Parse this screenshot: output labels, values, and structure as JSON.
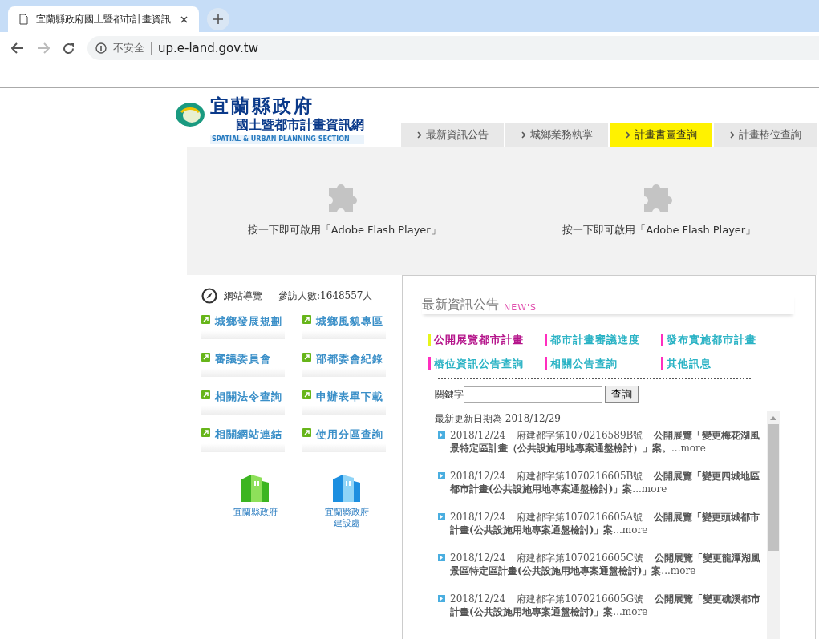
{
  "browser": {
    "tab_title": "宜蘭縣政府國土暨都市計畫資訊",
    "security": "不安全",
    "url": "up.e-land.gov.tw"
  },
  "logo": {
    "title": "宜蘭縣政府",
    "subtitle": "國土暨都市計畫資訊網",
    "english": "SPATIAL & URBAN PLANNING SECTION"
  },
  "nav_tabs": [
    {
      "label": "最新資訊公告",
      "selected": false
    },
    {
      "label": "城鄉業務執掌",
      "selected": false
    },
    {
      "label": "計畫書圖查詢",
      "selected": true
    },
    {
      "label": "計畫樁位查詢",
      "selected": false
    }
  ],
  "flash_placeholders": [
    "按一下即可啟用「Adobe Flash Player」",
    "按一下即可啟用「Adobe Flash Player」"
  ],
  "sidebar": {
    "sitemap": "網站導覽",
    "visitors": "參訪人數:1648557人",
    "links": [
      "城鄉發展規劃",
      "城鄉風貌專區",
      "審議委員會",
      "部都委會紀錄",
      "相關法令查詢",
      "申辦表單下載",
      "相關網站連結",
      "使用分區查詢"
    ],
    "agencies": [
      {
        "lines": [
          "宜蘭縣政府"
        ],
        "kind": "green"
      },
      {
        "lines": [
          "宜蘭縣政府",
          "建設處"
        ],
        "kind": "blue"
      }
    ]
  },
  "news": {
    "title": "最新資訊公告",
    "tag": "NEW'S",
    "categories": [
      {
        "label": "公開展覽都市計畫",
        "selected": true
      },
      {
        "label": "都市計畫審議進度",
        "selected": false
      },
      {
        "label": "發布實施都市計畫",
        "selected": false
      },
      {
        "label": "樁位資訊公告查詢",
        "selected": false
      },
      {
        "label": "相關公告查詢",
        "selected": false
      },
      {
        "label": "其他訊息",
        "selected": false
      }
    ],
    "search_label": "關鍵字",
    "search_button": "查詢",
    "updated": "最新更新日期為 2018/12/29",
    "items": [
      {
        "date": "2018/12/24",
        "number": "府建都字第1070216589B號",
        "title": "公開展覽「變更梅花湖風景特定區計畫（公共設施用地專案通盤檢討）」案。",
        "more": "...more"
      },
      {
        "date": "2018/12/24",
        "number": "府建都字第1070216605B號",
        "title": "公開展覽「變更四城地區都市計畫(公共設施用地專案通盤檢討)」案",
        "more": "...more"
      },
      {
        "date": "2018/12/24",
        "number": "府建都字第1070216605A號",
        "title": "公開展覽「變更頭城都市計畫(公共設施用地專案通盤檢討)」案",
        "more": "...more"
      },
      {
        "date": "2018/12/24",
        "number": "府建都字第1070216605C號",
        "title": "公開展覽「變更龍潭湖風景區特定區計畫(公共設施用地專案通盤檢討)」案",
        "more": "...more"
      },
      {
        "date": "2018/12/24",
        "number": "府建都字第1070216605G號",
        "title": "公開展覽「變更礁溪都市計畫(公共設施用地專案通盤檢討)」案",
        "more": "...more"
      }
    ]
  }
}
